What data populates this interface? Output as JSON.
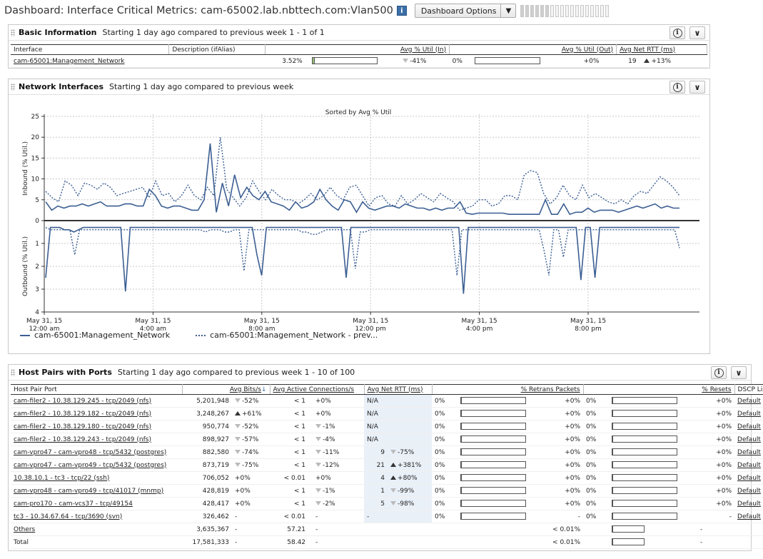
{
  "header": {
    "title": "Dashboard: Interface Critical Metrics: cam-65002.lab.nbttech.com:Vlan500",
    "info_label": "i",
    "options_label": "Dashboard Options"
  },
  "basic": {
    "title": "Basic Information",
    "subtitle": "Starting 1 day ago compared to previous week 1 - 1 of 1",
    "columns": [
      "Interface",
      "Description (ifAlias)",
      "Avg % Util (In)",
      "Avg % Util (Out)",
      "Avg Net RTT (ms)"
    ],
    "row": {
      "interface": "cam-65001:Management_Network",
      "util_in": "3.52%",
      "util_in_fill": 0.0352,
      "util_in_change": "-41%",
      "util_out": "0%",
      "util_out_fill": 0,
      "util_out_change": "+0%",
      "rtt": "19",
      "rtt_change": "+13%"
    }
  },
  "network": {
    "title": "Network Interfaces",
    "subtitle": "Starting 1 day ago compared to previous week",
    "legend": [
      "cam-65001:Management_Network",
      "cam-65001:Management_Network - prev..."
    ]
  },
  "chart_data": {
    "type": "line",
    "title": "Sorted by Avg % Util",
    "ylabel_top": "Inbound (% Util.)",
    "ylabel_bottom": "Outbound (% Util.)",
    "y_top_ticks": [
      "25",
      "20",
      "15",
      "10",
      "5",
      "0"
    ],
    "y_bottom_ticks": [
      "1",
      "2",
      "3",
      "4"
    ],
    "ylim_top": [
      0,
      25
    ],
    "ylim_bottom": [
      0,
      4
    ],
    "x_ticks": [
      [
        "May 31, 15",
        "12:00 am"
      ],
      [
        "May 31, 15",
        "4:00 am"
      ],
      [
        "May 31, 15",
        "8:00 am"
      ],
      [
        "May 31, 15",
        "12:00 pm"
      ],
      [
        "May 31, 15",
        "4:00 pm"
      ],
      [
        "May 31, 15",
        "8:00 pm"
      ]
    ],
    "x_range_hours": [
      0,
      24
    ],
    "grid": true,
    "series": [
      {
        "name": "cam-65001:Management_Network",
        "style": "solid",
        "inbound": [
          4.5,
          2.5,
          3.5,
          3,
          3.5,
          3.5,
          4,
          3.5,
          4,
          4.5,
          3.5,
          3.5,
          3.5,
          4,
          4,
          3.5,
          3.5,
          7.5,
          6,
          3.5,
          3,
          3.5,
          3.5,
          3,
          2.5,
          2.5,
          5,
          18.5,
          2,
          9,
          3.5,
          11,
          5.5,
          8,
          6,
          5,
          7,
          4.5,
          4,
          3.5,
          2.5,
          4.5,
          3,
          3.5,
          4.5,
          7.5,
          5,
          3.5,
          2.5,
          5,
          4.5,
          2,
          4.5,
          3,
          2.5,
          3,
          3.5,
          3.5,
          3,
          4,
          3.5,
          3,
          3,
          2.5,
          3,
          2.5,
          3,
          3,
          4.5,
          1.8,
          1.5,
          1.8,
          1.8,
          1.8,
          1.8,
          1.8,
          1.5,
          1.5,
          1.5,
          1.5,
          1.5,
          1.5,
          5,
          1.5,
          1.5,
          4,
          1.5,
          2,
          2,
          3,
          2,
          2.5,
          2.5,
          2.5,
          2,
          2.5,
          3,
          3.5,
          3,
          3.5,
          4,
          3,
          3.5,
          3,
          3
        ],
        "outbound": [
          2.5,
          0.3,
          0.3,
          0.3,
          0.4,
          0.4,
          0.5,
          0.4,
          0.3,
          0.3,
          0.3,
          0.3,
          0.3,
          0.3,
          0.3,
          0.3,
          0.3,
          3.1,
          0.3,
          0.3,
          0.3,
          0.3,
          0.3,
          0.3,
          0.3,
          0.3,
          0.3,
          0.3,
          0.3,
          0.3,
          0.3,
          0.3,
          0.3,
          0.3,
          0.3,
          0.3,
          0.3,
          0.3,
          0.3,
          0.3,
          0.3,
          0.3,
          0.3,
          0.3,
          0.3,
          1.5,
          2.4,
          0.3,
          0.3,
          0.3,
          0.3,
          0.3,
          0.3,
          0.3,
          0.3,
          0.3,
          0.3,
          0.3,
          0.3,
          0.3,
          0.3,
          0.3,
          0.3,
          0.3,
          2.5,
          0.3,
          0.3,
          0.3,
          0.3,
          0.3,
          0.3,
          0.3,
          0.3,
          0.3,
          0.3,
          0.3,
          0.3,
          0.3,
          0.3,
          0.3,
          0.3,
          0.3,
          0.3,
          0.3,
          0.3,
          0.3,
          0.3,
          0.3,
          0.3,
          3.2,
          0.3,
          0.3,
          0.3,
          0.3,
          0.3,
          0.3,
          0.3,
          0.3,
          0.3,
          0.3,
          0.3,
          0.3,
          0.3,
          0.3,
          0.3,
          0.3,
          0.3,
          0.3,
          0.3,
          0.3,
          0.3,
          0.3,
          0.3,
          0.3,
          2.6,
          0.3,
          0.3,
          2.5,
          0.3,
          0.3,
          0.3,
          0.3,
          0.3,
          0.3,
          0.3,
          0.3,
          0.3,
          0.3,
          0.3,
          0.3,
          0.3,
          0.3,
          0.3,
          0.3,
          0.3,
          0.3
        ]
      },
      {
        "name": "cam-65001:Management_Network - prev...",
        "style": "dotted",
        "inbound": [
          7,
          5.5,
          4.5,
          9.5,
          8.5,
          6,
          9,
          8.5,
          7.5,
          9,
          8,
          6,
          6.5,
          7,
          7.5,
          8,
          5.5,
          9.5,
          6,
          6.5,
          4.5,
          6,
          8.5,
          6,
          5,
          8,
          6,
          20,
          7.5,
          5.5,
          3.5,
          5.5,
          9.5,
          7,
          5,
          7.5,
          6,
          5,
          5,
          4,
          5,
          6.5,
          5,
          6,
          8,
          6,
          5,
          8,
          8.5,
          6,
          3.5,
          5.5,
          6,
          4,
          3.5,
          6,
          4,
          5,
          6.5,
          5.5,
          4.5,
          6.5,
          5.5,
          4.5,
          2.5,
          3,
          3.5,
          5,
          5,
          3.5,
          4,
          6,
          6,
          5,
          11,
          12,
          11.5,
          6.5,
          4,
          5.5,
          8.5,
          6,
          5,
          8.5,
          5.5,
          6.5,
          5.5,
          4.5,
          4,
          5,
          4,
          6,
          7,
          6.5,
          8.5,
          10.5,
          9.5,
          8,
          6
        ],
        "outbound": [
          0.3,
          0.4,
          0.4,
          0.4,
          0.4,
          0.4,
          1.5,
          0.4,
          0.4,
          0.4,
          0.4,
          0.4,
          0.4,
          0.4,
          0.4,
          0.4,
          0.4,
          0.4,
          0.4,
          0.4,
          0.4,
          0.4,
          0.4,
          0.4,
          0.4,
          0.4,
          0.4,
          0.4,
          0.4,
          0.4,
          0.4,
          0.4,
          0.4,
          0.5,
          0.4,
          0.4,
          0.4,
          0.5,
          0.5,
          0.4,
          0.4,
          2.2,
          0.4,
          0.4,
          0.4,
          0.4,
          0.4,
          0.4,
          0.4,
          0.4,
          0.4,
          0.4,
          0.4,
          0.5,
          0.5,
          0.6,
          0.6,
          0.5,
          0.4,
          0.4,
          0.4,
          0.4,
          0.4,
          0.4,
          2.1,
          0.5,
          0.5,
          0.4,
          0.4,
          0.4,
          0.4,
          0.4,
          0.4,
          0.4,
          0.4,
          0.4,
          0.4,
          0.4,
          0.4,
          0.4,
          0.4,
          0.4,
          0.4,
          0.4,
          0.4,
          2.4,
          0.4,
          0.4,
          0.4,
          0.4,
          0.4,
          0.4,
          0.4,
          0.4,
          0.4,
          0.4,
          0.4,
          0.4,
          0.4,
          0.4,
          0.4,
          0.4,
          0.4,
          1.3,
          2.4,
          0.4,
          0.4,
          1.6,
          0.4,
          0.4,
          0.4,
          0.4,
          0.4,
          0.4,
          0.4,
          0.4,
          0.4,
          0.4,
          0.4,
          0.4,
          0.4,
          0.4,
          0.4,
          0.4,
          0.4,
          0.4,
          0.4,
          0.4,
          0.4,
          0.4,
          0.4,
          1.2
        ]
      }
    ]
  },
  "hostpairs": {
    "title": "Host Pairs with Ports",
    "subtitle": "Starting 1 day ago compared to previous week 1 - 10 of 100",
    "columns": [
      "Host Pair Port",
      "Avg Bits/s",
      "Avg Active Connections/s",
      "Avg Net RTT (ms)",
      "% Retrans Packets",
      "% Resets",
      "DSCP List"
    ],
    "sort_indicator": "↓",
    "rows": [
      {
        "name": "cam-filer2 - 10.38.129.245 - tcp/2049 (nfs)",
        "bits": "5,201,948",
        "bits_dir": "dn",
        "bits_chg": "-52%",
        "conn": "< 1",
        "conn_dir": "",
        "conn_chg": "+0%",
        "rtt": "N/A",
        "rtt_dir": "",
        "rtt_chg": "",
        "retr": "0%",
        "retr_chg": "+0%",
        "rst": "0%",
        "rst_chg": "+0%",
        "dscp": "Default"
      },
      {
        "name": "cam-filer2 - 10.38.129.182 - tcp/2049 (nfs)",
        "bits": "3,248,267",
        "bits_dir": "up",
        "bits_chg": "+61%",
        "conn": "< 1",
        "conn_dir": "",
        "conn_chg": "+0%",
        "rtt": "N/A",
        "rtt_dir": "",
        "rtt_chg": "",
        "retr": "0%",
        "retr_chg": "+0%",
        "rst": "0%",
        "rst_chg": "+0%",
        "dscp": "Default"
      },
      {
        "name": "cam-filer2 - 10.38.129.180 - tcp/2049 (nfs)",
        "bits": "950,774",
        "bits_dir": "dn",
        "bits_chg": "-52%",
        "conn": "< 1",
        "conn_dir": "dn",
        "conn_chg": "-1%",
        "rtt": "N/A",
        "rtt_dir": "",
        "rtt_chg": "",
        "retr": "0%",
        "retr_chg": "+0%",
        "rst": "0%",
        "rst_chg": "+0%",
        "dscp": "Default"
      },
      {
        "name": "cam-filer2 - 10.38.129.243 - tcp/2049 (nfs)",
        "bits": "898,927",
        "bits_dir": "dn",
        "bits_chg": "-57%",
        "conn": "< 1",
        "conn_dir": "dn",
        "conn_chg": "-4%",
        "rtt": "N/A",
        "rtt_dir": "",
        "rtt_chg": "",
        "retr": "0%",
        "retr_chg": "+0%",
        "rst": "0%",
        "rst_chg": "+0%",
        "dscp": "Default"
      },
      {
        "name": "cam-vpro47 - cam-vpro48 - tcp/5432 (postgres)",
        "bits": "882,580",
        "bits_dir": "dn",
        "bits_chg": "-74%",
        "conn": "< 1",
        "conn_dir": "dn",
        "conn_chg": "-11%",
        "rtt": "9",
        "rtt_dir": "dn",
        "rtt_chg": "-75%",
        "retr": "0%",
        "retr_chg": "+0%",
        "rst": "0%",
        "rst_chg": "+0%",
        "dscp": "Default"
      },
      {
        "name": "cam-vpro47 - cam-vpro49 - tcp/5432 (postgres)",
        "bits": "873,719",
        "bits_dir": "dn",
        "bits_chg": "-75%",
        "conn": "< 1",
        "conn_dir": "dn",
        "conn_chg": "-12%",
        "rtt": "21",
        "rtt_dir": "up",
        "rtt_chg": "+381%",
        "retr": "0%",
        "retr_chg": "+0%",
        "rst": "0%",
        "rst_chg": "+0%",
        "dscp": "Default"
      },
      {
        "name": "10.38.10.1 - tc3 - tcp/22 (ssh)",
        "bits": "706,052",
        "bits_dir": "",
        "bits_chg": "+0%",
        "conn": "< 0.01",
        "conn_dir": "",
        "conn_chg": "+0%",
        "rtt": "4",
        "rtt_dir": "up",
        "rtt_chg": "+80%",
        "retr": "0%",
        "retr_chg": "+0%",
        "rst": "0%",
        "rst_chg": "+0%",
        "dscp": "Default"
      },
      {
        "name": "cam-vpro48 - cam-vpro49 - tcp/41017 (mnmp)",
        "bits": "428,819",
        "bits_dir": "",
        "bits_chg": "+0%",
        "conn": "< 1",
        "conn_dir": "dn",
        "conn_chg": "-1%",
        "rtt": "1",
        "rtt_dir": "dn",
        "rtt_chg": "-99%",
        "retr": "0%",
        "retr_chg": "+0%",
        "rst": "0%",
        "rst_chg": "+0%",
        "dscp": "Default"
      },
      {
        "name": "cam-pro170 - cam-vcs37 - tcp/49154",
        "bits": "428,417",
        "bits_dir": "",
        "bits_chg": "+0%",
        "conn": "< 1",
        "conn_dir": "dn",
        "conn_chg": "-2%",
        "rtt": "5",
        "rtt_dir": "dn",
        "rtt_chg": "-98%",
        "retr": "0%",
        "retr_chg": "+0%",
        "rst": "0%",
        "rst_chg": "+0%",
        "dscp": "Default"
      },
      {
        "name": "tc3 - 10.34.67.64 - tcp/3690 (svn)",
        "bits": "326,462",
        "bits_dir": "",
        "bits_chg": "-",
        "conn": "< 0.01",
        "conn_dir": "",
        "conn_chg": "-",
        "rtt": "-",
        "rtt_dir": "",
        "rtt_chg": "",
        "retr": "0%",
        "retr_chg": "-",
        "rst": "0%",
        "rst_chg": "-",
        "dscp": "Default"
      }
    ],
    "others": {
      "name": "Others",
      "bits": "3,635,367",
      "bits_chg": "-",
      "conn": "57.21",
      "conn_chg": "-",
      "rst": "< 0.01%",
      "rst_chg": "-"
    },
    "total": {
      "name": "Total",
      "bits": "17,581,333",
      "bits_chg": "-",
      "conn": "58.42",
      "conn_chg": "-",
      "rst": "< 0.01%",
      "rst_chg": "-"
    }
  }
}
